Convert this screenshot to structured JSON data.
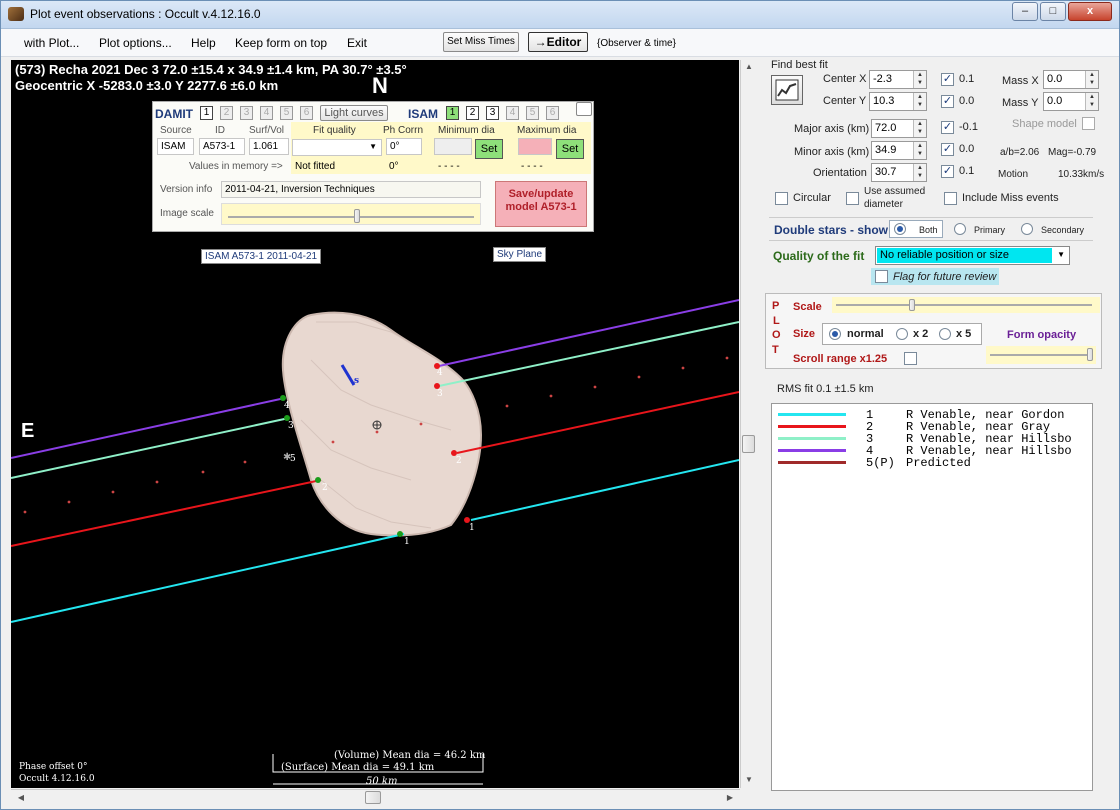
{
  "window": {
    "title": "Plot event observations : Occult v.4.12.16.0",
    "min_label": "–",
    "max_label": "□",
    "close_label": "x"
  },
  "menu": {
    "items": [
      "with Plot...",
      "Plot options...",
      "Help",
      "Keep form on top",
      "Exit"
    ],
    "set_miss_times": "Set Miss Times",
    "editor": "→Editor",
    "observer_time": "{Observer & time}"
  },
  "plot": {
    "header_line1": "(573) Recha  2021 Dec 3   72.0 ±15.4 x 34.9 ±1.4 km,  PA 30.7° ±3.5°",
    "header_line2": "Geocentric  X  -5283.0 ±3.0  Y 2277.6 ±6.0 km",
    "north": "N",
    "east": "E",
    "isam_chip": "ISAM A573-1 2011-04-21",
    "sky_chip": "Sky Plane",
    "phase_offset": "Phase offset 0°",
    "version": "Occult 4.12.16.0",
    "volume_dia": "(Volume) Mean dia = 46.2 km",
    "surface_dia": "(Surface) Mean dia = 49.1 km",
    "scale_bar": "50 km",
    "chord_labels": [
      "1",
      "2",
      "3",
      "4",
      "5"
    ],
    "pole_label": "s"
  },
  "overlay": {
    "damit": "DAMIT",
    "damit_nums": [
      "1",
      "2",
      "3",
      "4",
      "5",
      "6"
    ],
    "light_curves": "Light curves",
    "isam": "ISAM",
    "isam_nums": [
      "1",
      "2",
      "3",
      "4",
      "5",
      "6"
    ],
    "headers": {
      "source": "Source",
      "id": "ID",
      "surf_vol": "Surf/Vol",
      "fit_quality": "Fit quality",
      "ph_corrn": "Ph Corrn",
      "min_dia": "Minimum dia",
      "max_dia": "Maximum dia"
    },
    "source": "ISAM",
    "id": "A573-1",
    "surf_vol": "1.061",
    "ph_corrn": "0°",
    "values_in_memory": "Values in memory =>",
    "not_fitted": "Not fitted",
    "mem_ph": "0°",
    "mem_min": "- - - -",
    "mem_max": "- - - -",
    "set_label": "Set",
    "version_info_label": "Version info",
    "version_info": "2011-04-21, Inversion Techniques",
    "image_scale_label": "Image scale",
    "save_update": "Save/update",
    "save_model": "model A573-1"
  },
  "fit": {
    "find_best_fit": "Find best fit",
    "center_x_label": "Center X",
    "center_x": "-2.3",
    "center_x_step": "0.1",
    "center_y_label": "Center Y",
    "center_y": "10.3",
    "center_y_step": "0.0",
    "mass_x_label": "Mass X",
    "mass_x": "0.0",
    "mass_y_label": "Mass Y",
    "mass_y": "0.0",
    "shape_model": "Shape model",
    "major_label": "Major axis (km)",
    "major": "72.0",
    "major_step": "-0.1",
    "minor_label": "Minor axis (km)",
    "minor": "34.9",
    "minor_step": "0.0",
    "ab_ratio": "a/b=2.06",
    "mag": "Mag=-0.79",
    "orient_label": "Orientation",
    "orient": "30.7",
    "orient_step": "0.1",
    "motion_label": "Motion",
    "motion": "10.33km/s",
    "circular": "Circular",
    "use_assumed": "Use assumed",
    "diameter": "diameter",
    "include_miss": "Include Miss events"
  },
  "double_stars": {
    "label": "Double stars - show",
    "both": "Both",
    "primary": "Primary",
    "secondary": "Secondary"
  },
  "quality": {
    "label": "Quality of the fit",
    "value": "No reliable position or size",
    "flag": "Flag for future review"
  },
  "plot_opts": {
    "vertical": [
      "P",
      "L",
      "O",
      "T"
    ],
    "scale": "Scale",
    "size": "Size",
    "normal": "normal",
    "x2": "x 2",
    "x5": "x 5",
    "form_opacity": "Form opacity",
    "scroll_range": "Scroll range x1.25"
  },
  "rms": "RMS fit 0.1 ±1.5 km",
  "legend": [
    {
      "num": "1",
      "name": "R Venable, near Gordon",
      "color": "#24e6f0"
    },
    {
      "num": "2",
      "name": "R Venable, near Gray",
      "color": "#e8151b"
    },
    {
      "num": "3",
      "name": "R Venable, near Hillsbo",
      "color": "#8ff0c8"
    },
    {
      "num": "4",
      "name": "R Venable, near Hillsbo",
      "color": "#8a3ee6"
    },
    {
      "num": "5(P)",
      "name": "Predicted",
      "color": "#a02a2a"
    }
  ]
}
